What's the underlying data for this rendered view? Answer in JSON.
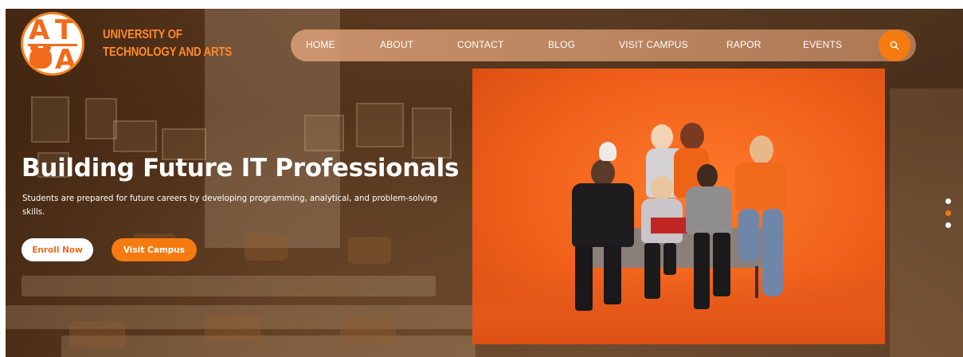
{
  "brand": {
    "logo_letters": [
      "A",
      "T",
      "A"
    ],
    "name": "UNIVERSITY OF TECHNOLOGY AND ARTS"
  },
  "nav": {
    "items": [
      "HOME",
      "ABOUT",
      "CONTACT",
      "BLOG",
      "VISIT CAMPUS",
      "RAPOR",
      "EVENTS"
    ],
    "search_icon": "search-icon"
  },
  "hero": {
    "headline": "Building Future IT Professionals",
    "subtext": "Students are prepared for future careers by developing programming, analytical, and problem-solving skills.",
    "enroll_label": "Enroll Now",
    "visit_label": "Visit Campus",
    "photo_alt": "Group of students posing on orange background"
  },
  "slider": {
    "dot_count": 3,
    "active_index": 1
  },
  "colors": {
    "accent": "#f57a10",
    "brand_text": "#ff8a2a",
    "white": "#ffffff"
  }
}
